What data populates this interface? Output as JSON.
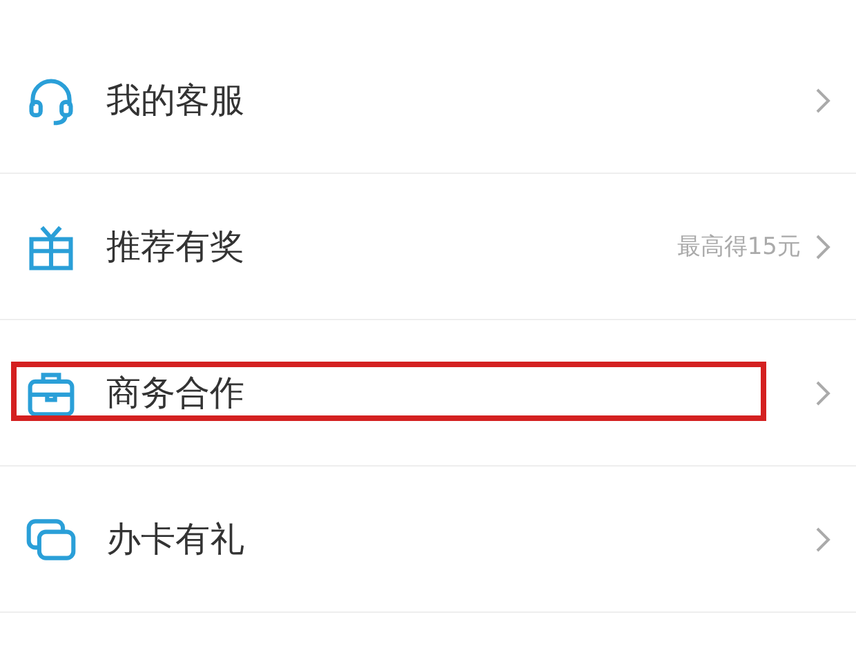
{
  "menu_items": [
    {
      "kind": "headset",
      "label": "我的客服",
      "highlighted": false
    },
    {
      "kind": "gift",
      "label": "推荐有奖",
      "hint": "最高得15元",
      "highlighted": false
    },
    {
      "kind": "briefcase",
      "label": "商务合作",
      "highlighted": true
    },
    {
      "kind": "cards",
      "label": "办卡有礼",
      "highlighted": false
    }
  ]
}
